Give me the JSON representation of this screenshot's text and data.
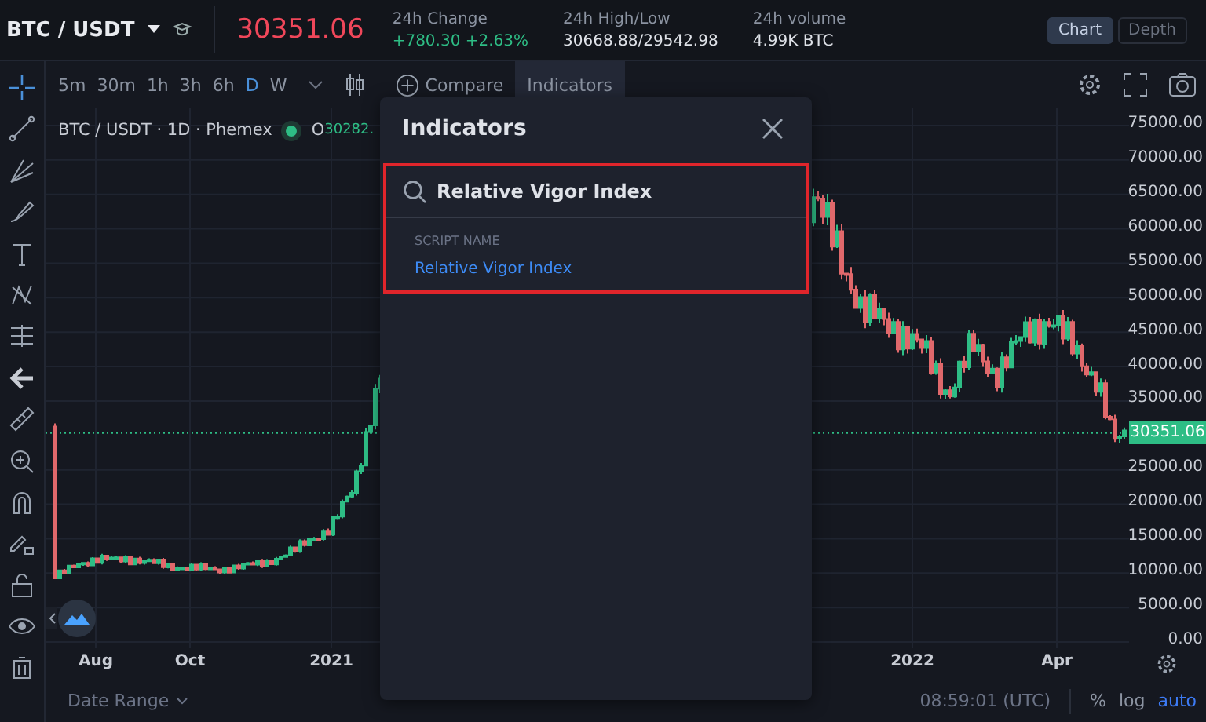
{
  "header": {
    "symbol": "BTC / USDT",
    "last_price": "30351.06",
    "stats": [
      {
        "label": "24h Change",
        "value": "+780.30 +2.63%",
        "kind": "up"
      },
      {
        "label": "24h High/Low",
        "value": "30668.88/29542.98",
        "kind": "plain"
      },
      {
        "label": "24h volume",
        "value": "4.99K BTC",
        "kind": "plain"
      }
    ],
    "views": [
      {
        "label": "Chart",
        "selected": true
      },
      {
        "label": "Depth",
        "selected": false
      }
    ]
  },
  "toolbar": {
    "intervals": [
      {
        "label": "5m",
        "selected": false
      },
      {
        "label": "30m",
        "selected": false
      },
      {
        "label": "1h",
        "selected": false
      },
      {
        "label": "3h",
        "selected": false
      },
      {
        "label": "6h",
        "selected": false
      },
      {
        "label": "D",
        "selected": true
      },
      {
        "label": "W",
        "selected": false
      }
    ],
    "compare": "Compare",
    "indicators": "Indicators"
  },
  "legend": {
    "title": "BTC / USDT · 1D · Phemex",
    "open_label": "O",
    "open_value": "30282."
  },
  "price_axis": [
    "75000.00",
    "70000.00",
    "65000.00",
    "60000.00",
    "55000.00",
    "50000.00",
    "45000.00",
    "40000.00",
    "35000.00",
    "25000.00",
    "20000.00",
    "15000.00",
    "10000.00",
    "5000.00",
    "0.00"
  ],
  "price_tag": "30351.06",
  "date_axis": [
    "Aug",
    "Oct",
    "2021",
    "2022",
    "Apr"
  ],
  "bottom_bar": {
    "date_range": "Date Range",
    "time": "08:59:01 (UTC)",
    "percent": "%",
    "log": "log",
    "auto": "auto",
    "auto_on": true
  },
  "dialog": {
    "title": "Indicators",
    "search_value": "Relative Vigor Index",
    "section": "SCRIPT NAME",
    "results": [
      {
        "label": "Relative Vigor Index"
      }
    ]
  }
}
